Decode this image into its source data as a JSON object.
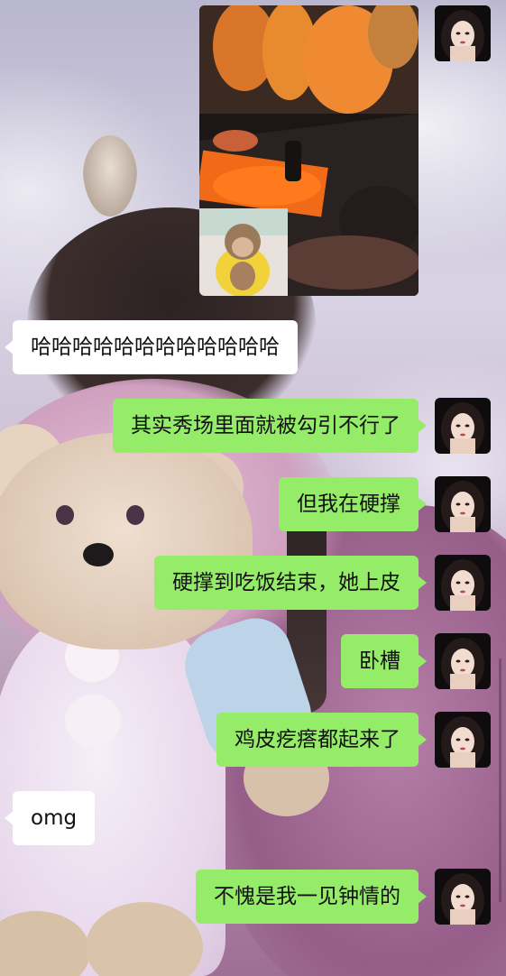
{
  "conversation": {
    "photo_message": {
      "sender": "me",
      "type": "image"
    },
    "messages": [
      {
        "sender": "them",
        "text": "哈哈哈哈哈哈哈哈哈哈哈哈"
      },
      {
        "sender": "me",
        "text": "其实秀场里面就被勾引不行了"
      },
      {
        "sender": "me",
        "text": "但我在硬撑"
      },
      {
        "sender": "me",
        "text": "硬撑到吃饭结束，她上皮"
      },
      {
        "sender": "me",
        "text": "卧槽"
      },
      {
        "sender": "me",
        "text": "鸡皮疙瘩都起来了"
      },
      {
        "sender": "them",
        "text": "omg"
      },
      {
        "sender": "me",
        "text": "不愧是我一见钟情的"
      }
    ]
  },
  "colors": {
    "my_bubble": "#95ec69",
    "their_bubble": "#ffffff"
  }
}
